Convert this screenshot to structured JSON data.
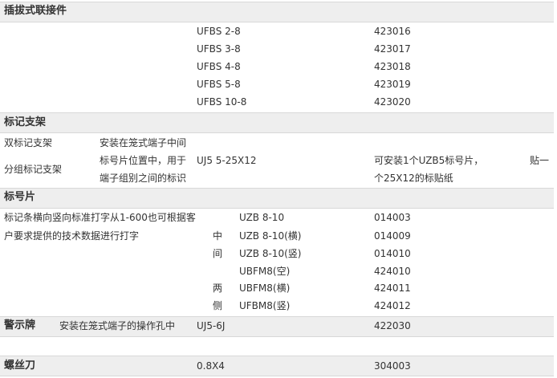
{
  "sections": {
    "plug": {
      "title": "插拔式联接件",
      "rows": [
        {
          "model": "UFBS 2-8",
          "code": "423016"
        },
        {
          "model": "UFBS 3-8",
          "code": "423017"
        },
        {
          "model": "UFBS 4-8",
          "code": "423018"
        },
        {
          "model": "UFBS 5-8",
          "code": "423019"
        },
        {
          "model": "UFBS 10-8",
          "code": "423020"
        }
      ]
    },
    "marker_holder": {
      "title": "标记支架",
      "name1": "双标记支架",
      "name2": "分组标记支架",
      "desc1": "安装在笼式端子中间",
      "desc2": "标号片位置中，用于",
      "desc3": "端子组别之间的标识",
      "model": "UJ5 5-25X12",
      "note1": "可安装1个UZB5标号片，",
      "note2": "个25X12的标贴纸",
      "note_right": "贴一"
    },
    "marker_strip": {
      "title": "标号片",
      "desc1": "标记条横向竖向标准打字从1-600也可根据客",
      "desc2": "户要求提供的技术数据进行打字",
      "mid1": "中",
      "mid2": "间",
      "side1": "两",
      "side2": "侧",
      "rows": [
        {
          "model": "UZB 8-10",
          "code": "014003"
        },
        {
          "model": "UZB 8-10(横)",
          "code": "014009"
        },
        {
          "model": "UZB 8-10(竖)",
          "code": "014010"
        },
        {
          "model": "UBFM8(空)",
          "code": "424010"
        },
        {
          "model": "UBFM8(横)",
          "code": "424011"
        },
        {
          "model": "UFBM8(竖)",
          "code": "424012"
        }
      ]
    },
    "warning": {
      "title": "警示牌",
      "desc": "安装在笼式端子的操作孔中",
      "model": "UJ5-6J",
      "code": "422030"
    },
    "screwdriver": {
      "title": "螺丝刀",
      "model": "0.8X4",
      "code": "304003"
    }
  }
}
